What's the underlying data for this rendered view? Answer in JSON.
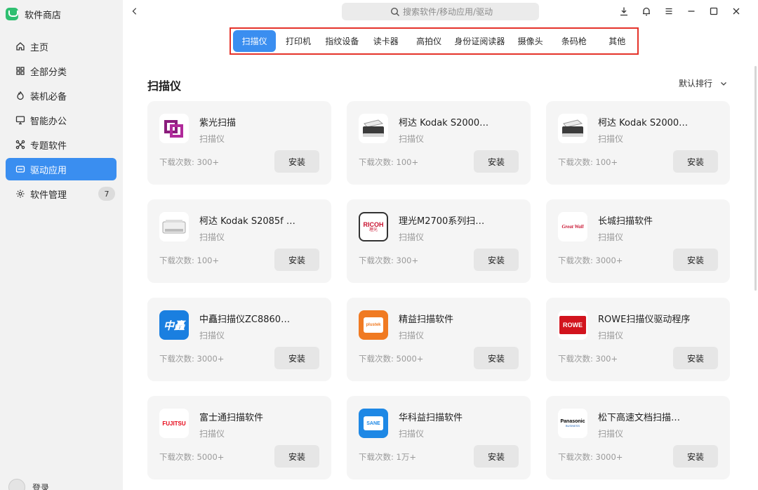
{
  "app": {
    "title": "软件商店"
  },
  "sidebar": {
    "items": [
      {
        "label": "主页",
        "icon": "home-icon"
      },
      {
        "label": "全部分类",
        "icon": "grid-icon"
      },
      {
        "label": "装机必备",
        "icon": "fire-icon"
      },
      {
        "label": "智能办公",
        "icon": "monitor-icon"
      },
      {
        "label": "专题软件",
        "icon": "topic-icon"
      },
      {
        "label": "驱动应用",
        "icon": "driver-icon",
        "active": true
      },
      {
        "label": "软件管理",
        "icon": "gear-icon",
        "badge": "7"
      }
    ],
    "login_label": "登录"
  },
  "search": {
    "placeholder": "搜索软件/移动应用/驱动"
  },
  "tabs": [
    {
      "label": "扫描仪",
      "active": true
    },
    {
      "label": "打印机"
    },
    {
      "label": "指纹设备"
    },
    {
      "label": "读卡器"
    },
    {
      "label": "高拍仪"
    },
    {
      "label": "身份证阅读器"
    },
    {
      "label": "摄像头"
    },
    {
      "label": "条码枪"
    },
    {
      "label": "其他"
    }
  ],
  "main": {
    "section_title": "扫描仪",
    "sort_label": "默认排行",
    "download_prefix": "下载次数:",
    "install_label": "安装",
    "apps": [
      {
        "name": "紫光扫描",
        "category": "扫描仪",
        "downloads": "300+",
        "icon": "unis-logo-icon"
      },
      {
        "name": "柯达 Kodak S2000…",
        "category": "扫描仪",
        "downloads": "100+",
        "icon": "kodak-scanner-icon"
      },
      {
        "name": "柯达 Kodak S2000…",
        "category": "扫描仪",
        "downloads": "100+",
        "icon": "kodak-scanner-icon"
      },
      {
        "name": "柯达 Kodak S2085f …",
        "category": "扫描仪",
        "downloads": "100+",
        "icon": "kodak-s2085f-icon"
      },
      {
        "name": "理光M2700系列扫…",
        "category": "扫描仪",
        "downloads": "300+",
        "icon": "ricoh-logo-icon",
        "logo_text": "RICOH",
        "logo_sub": "理光"
      },
      {
        "name": "长城扫描软件",
        "category": "扫描仪",
        "downloads": "3000+",
        "icon": "greatwall-logo-icon",
        "logo_text": "Great Wall"
      },
      {
        "name": "中矗扫描仪ZC8860…",
        "category": "扫描仪",
        "downloads": "3000+",
        "icon": "zhongchu-logo-icon",
        "logo_text": "中矗"
      },
      {
        "name": "精益扫描软件",
        "category": "扫描仪",
        "downloads": "5000+",
        "icon": "jingyi-logo-icon",
        "logo_text": "plustek"
      },
      {
        "name": "ROWE扫描仪驱动程序",
        "category": "扫描仪",
        "downloads": "300+",
        "icon": "rowe-logo-icon",
        "logo_text": "ROWE"
      },
      {
        "name": "富士通扫描软件",
        "category": "扫描仪",
        "downloads": "5000+",
        "icon": "fujitsu-logo-icon",
        "logo_text": "FUJITSU"
      },
      {
        "name": "华科益扫描软件",
        "category": "扫描仪",
        "downloads": "1万+",
        "icon": "sane-logo-icon",
        "logo_text": "SANE"
      },
      {
        "name": "松下高速文档扫描…",
        "category": "扫描仪",
        "downloads": "3000+",
        "icon": "panasonic-logo-icon",
        "logo_text": "Panasonic",
        "logo_sub": "BUSINESS"
      }
    ]
  },
  "colors": {
    "accent": "#3a8ef0",
    "highlight_border": "#e5332a",
    "card_bg": "#f5f5f5",
    "sidebar_bg": "#f2f2f2"
  }
}
